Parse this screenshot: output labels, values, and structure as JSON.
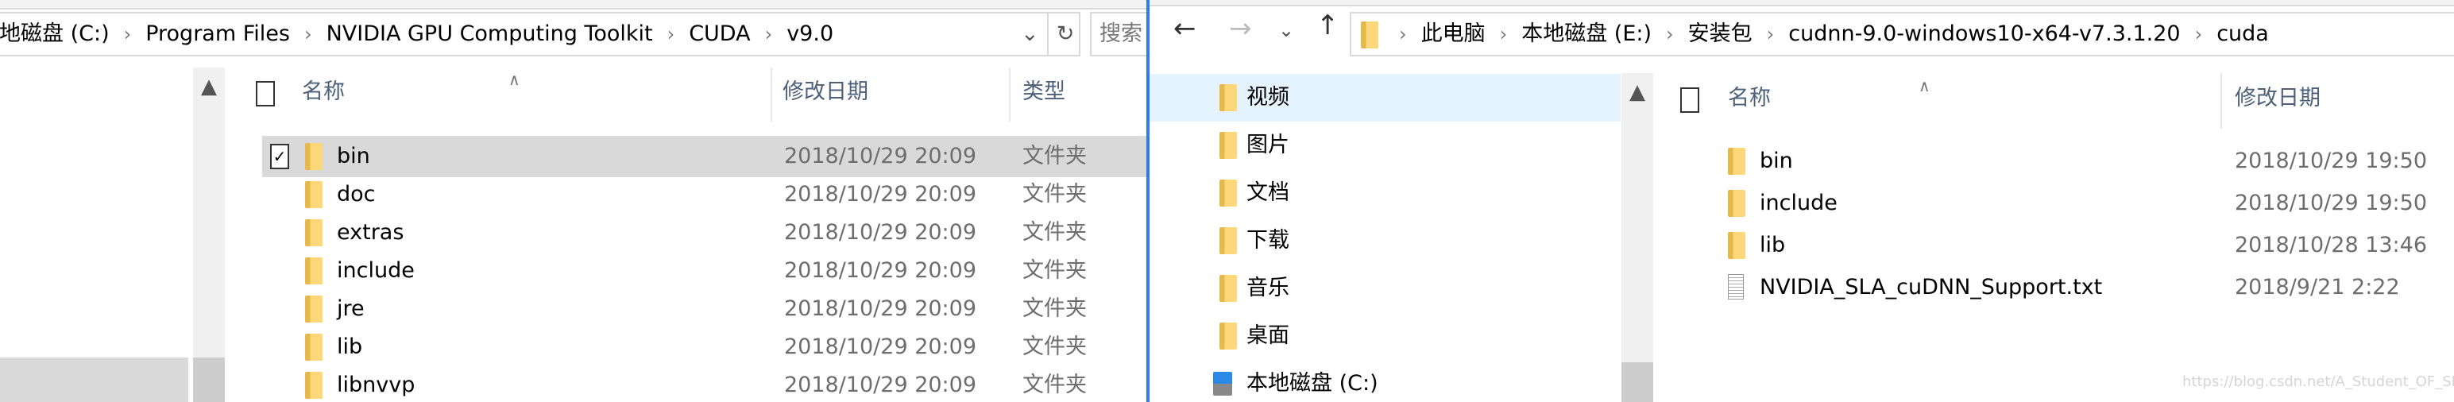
{
  "left_window": {
    "breadcrumbs": [
      "本地磁盘 (C:)",
      "Program Files",
      "NVIDIA GPU Computing Toolkit",
      "CUDA",
      "v9.0"
    ],
    "search_placeholder": "搜索",
    "columns": {
      "name": "名称",
      "modified": "修改日期",
      "type": "类型"
    },
    "files": [
      {
        "name": "bin",
        "modified": "2018/10/29 20:09",
        "type": "文件夹",
        "selected": true,
        "checked": true
      },
      {
        "name": "doc",
        "modified": "2018/10/29 20:09",
        "type": "文件夹"
      },
      {
        "name": "extras",
        "modified": "2018/10/29 20:09",
        "type": "文件夹"
      },
      {
        "name": "include",
        "modified": "2018/10/29 20:09",
        "type": "文件夹"
      },
      {
        "name": "jre",
        "modified": "2018/10/29 20:09",
        "type": "文件夹"
      },
      {
        "name": "lib",
        "modified": "2018/10/29 20:09",
        "type": "文件夹"
      },
      {
        "name": "libnvvp",
        "modified": "2018/10/29 20:09",
        "type": "文件夹"
      }
    ]
  },
  "right_window": {
    "breadcrumbs": [
      "此电脑",
      "本地磁盘 (E:)",
      "安装包",
      "cudnn-9.0-windows10-x64-v7.3.1.20",
      "cuda"
    ],
    "nav_items": [
      {
        "label": "视频",
        "icon": "videos-folder-icon",
        "selected": true
      },
      {
        "label": "图片",
        "icon": "pictures-folder-icon"
      },
      {
        "label": "文档",
        "icon": "documents-folder-icon"
      },
      {
        "label": "下载",
        "icon": "downloads-folder-icon"
      },
      {
        "label": "音乐",
        "icon": "music-folder-icon"
      },
      {
        "label": "桌面",
        "icon": "desktop-folder-icon"
      },
      {
        "label": "本地磁盘 (C:)",
        "icon": "drive-icon"
      }
    ],
    "columns": {
      "name": "名称",
      "modified": "修改日期"
    },
    "files": [
      {
        "name": "bin",
        "modified": "2018/10/29 19:50",
        "kind": "folder"
      },
      {
        "name": "include",
        "modified": "2018/10/29 19:50",
        "kind": "folder"
      },
      {
        "name": "lib",
        "modified": "2018/10/28 13:46",
        "kind": "folder"
      },
      {
        "name": "NVIDIA_SLA_cuDNN_Support.txt",
        "modified": "2018/9/21 2:22",
        "kind": "text"
      }
    ]
  },
  "watermark": "https://blog.csdn.net/A_Student_OF_SHANDA",
  "colors": {
    "accent": "#2b7de9",
    "selection_gray": "#d9d9d9",
    "nav_selected": "#e5f3ff",
    "folder": "#fcd87a"
  }
}
